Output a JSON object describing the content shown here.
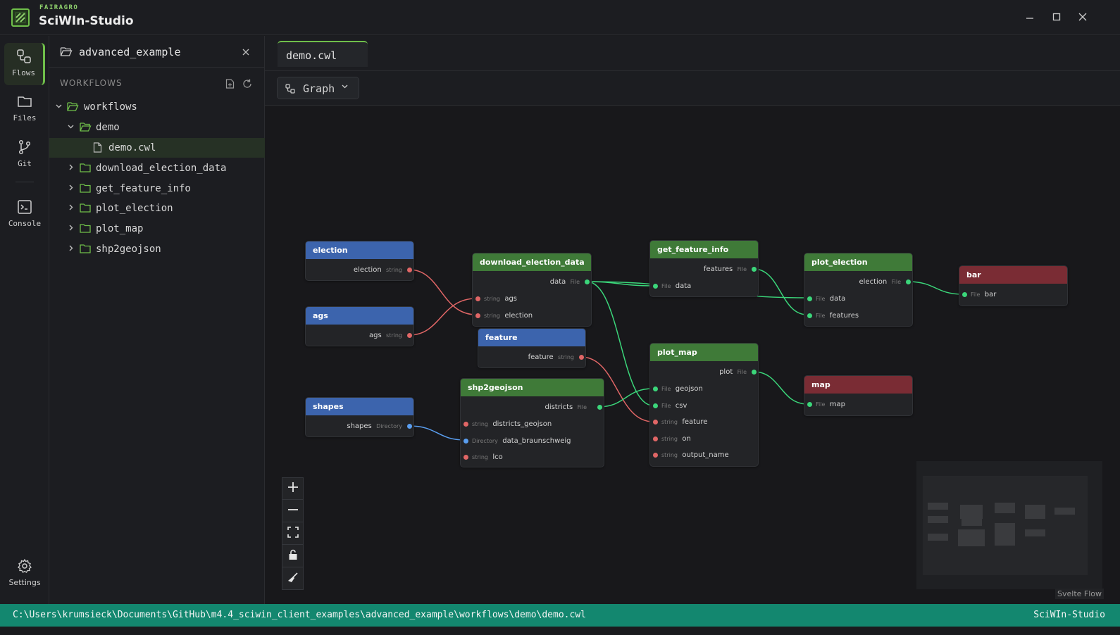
{
  "titlebar": {
    "brand_top": "FAIRAGRO",
    "brand_name": "SciWIn-Studio"
  },
  "activity": {
    "items": [
      {
        "label": "Flows",
        "icon": "flows-icon",
        "active": true
      },
      {
        "label": "Files",
        "icon": "folder-icon",
        "active": false
      },
      {
        "label": "Git",
        "icon": "git-branch-icon",
        "active": false
      },
      {
        "label": "Console",
        "icon": "terminal-icon",
        "active": false
      }
    ],
    "settings_label": "Settings"
  },
  "explorer": {
    "project_name": "advanced_example",
    "section_title": "WORKFLOWS",
    "tree": [
      {
        "label": "workflows",
        "expanded": true
      },
      {
        "label": "demo",
        "expanded": true
      },
      {
        "label": "demo.cwl",
        "selected": true
      },
      {
        "label": "download_election_data",
        "expanded": false
      },
      {
        "label": "get_feature_info",
        "expanded": false
      },
      {
        "label": "plot_election",
        "expanded": false
      },
      {
        "label": "plot_map",
        "expanded": false
      },
      {
        "label": "shp2geojson",
        "expanded": false
      }
    ]
  },
  "editor": {
    "tab_label": "demo.cwl",
    "view_mode": "Graph"
  },
  "graph": {
    "inputs": [
      {
        "title": "election",
        "out": {
          "name": "election",
          "type": "string"
        }
      },
      {
        "title": "ags",
        "out": {
          "name": "ags",
          "type": "string"
        }
      },
      {
        "title": "feature",
        "out": {
          "name": "feature",
          "type": "string"
        }
      },
      {
        "title": "shapes",
        "out": {
          "name": "shapes",
          "type": "Directory"
        }
      }
    ],
    "steps": {
      "download": {
        "title": "download_election_data",
        "out": {
          "name": "data",
          "type": "File"
        },
        "in": [
          {
            "name": "ags",
            "type": "string"
          },
          {
            "name": "election",
            "type": "string"
          }
        ]
      },
      "shp2geojson": {
        "title": "shp2geojson",
        "out": {
          "name": "districts",
          "type": "File"
        },
        "in": [
          {
            "name": "districts_geojson",
            "type": "string"
          },
          {
            "name": "data_braunschweig",
            "type": "Directory"
          },
          {
            "name": "lco",
            "type": "string"
          }
        ]
      },
      "getfeature": {
        "title": "get_feature_info",
        "out": {
          "name": "features",
          "type": "File"
        },
        "in": [
          {
            "name": "data",
            "type": "File"
          }
        ]
      },
      "plotmap": {
        "title": "plot_map",
        "out": {
          "name": "plot",
          "type": "File"
        },
        "in": [
          {
            "name": "geojson",
            "type": "File"
          },
          {
            "name": "csv",
            "type": "File"
          },
          {
            "name": "feature",
            "type": "string"
          },
          {
            "name": "on",
            "type": "string"
          },
          {
            "name": "output_name",
            "type": "string"
          }
        ]
      },
      "plotelection": {
        "title": "plot_election",
        "out": {
          "name": "election",
          "type": "File"
        },
        "in": [
          {
            "name": "data",
            "type": "File"
          },
          {
            "name": "features",
            "type": "File"
          }
        ]
      }
    },
    "outputs": [
      {
        "title": "bar",
        "in": {
          "name": "bar",
          "type": "File"
        }
      },
      {
        "title": "map",
        "in": {
          "name": "map",
          "type": "File"
        }
      }
    ],
    "attribution": "Svelte Flow"
  },
  "status": {
    "path": "C:\\Users\\krumsieck\\Documents\\GitHub\\m4.4_sciwin_client_examples\\advanced_example\\workflows\\demo\\demo.cwl",
    "app": "SciWIn-Studio"
  },
  "colors": {
    "accent": "#6fbf4a",
    "status_bar": "#13876f",
    "input_node": "#3c64ad",
    "step_node": "#3f7a38",
    "output_node": "#7a2c34",
    "string_port": "#e06666",
    "file_port": "#3bd67a",
    "directory_port": "#5a9ef0"
  }
}
